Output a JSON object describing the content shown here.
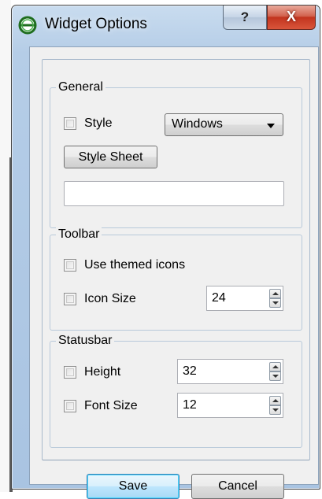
{
  "window": {
    "title": "Widget Options",
    "help_label": "?",
    "close_label": "X"
  },
  "general": {
    "title": "General",
    "style_label": "Style",
    "style_value": "Windows",
    "style_sheet_label": "Style Sheet",
    "style_sheet_value": ""
  },
  "toolbar": {
    "title": "Toolbar",
    "themed_icons_label": "Use themed icons",
    "icon_size_label": "Icon Size",
    "icon_size_value": "24"
  },
  "statusbar": {
    "title": "Statusbar",
    "height_label": "Height",
    "height_value": "32",
    "font_size_label": "Font Size",
    "font_size_value": "12"
  },
  "actions": {
    "save_label": "Save",
    "cancel_label": "Cancel"
  },
  "colors": {
    "accent": "#3c7fb1",
    "close": "#c2341e",
    "frame": "#b5cde7"
  },
  "icons": {
    "app": "green-circle-icon"
  }
}
